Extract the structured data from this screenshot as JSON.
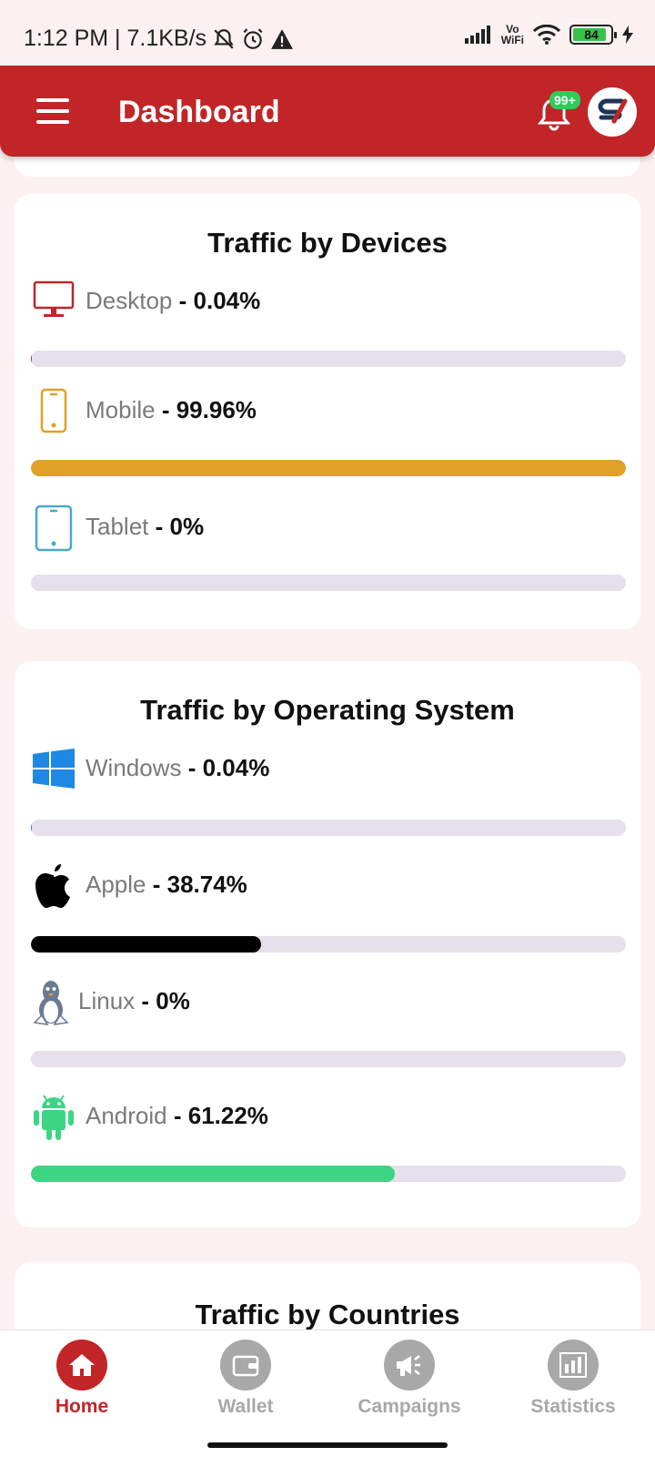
{
  "status_bar": {
    "time_speed": "1:12 PM | 7.1KB/s",
    "vowifi_top": "Vo",
    "vowifi_bottom": "WiFi",
    "battery": "84"
  },
  "appbar": {
    "title": "Dashboard",
    "notification_count": "99+"
  },
  "devices_card": {
    "title": "Traffic by Devices",
    "items": [
      {
        "label": "Desktop",
        "value": "- 0.04%",
        "percent": 0.04,
        "color": "#c12528"
      },
      {
        "label": "Mobile",
        "value": "- 99.96%",
        "percent": 99.96,
        "color": "#e0a126"
      },
      {
        "label": "Tablet",
        "value": "- 0%",
        "percent": 0,
        "color": "#4aa9c6"
      }
    ]
  },
  "os_card": {
    "title": "Traffic by Operating System",
    "items": [
      {
        "label": "Windows",
        "value": "- 0.04%",
        "percent": 0.04,
        "color": "#1e88e5"
      },
      {
        "label": "Apple",
        "value": "- 38.74%",
        "percent": 38.74,
        "color": "#000000"
      },
      {
        "label": "Linux",
        "value": "- 0%",
        "percent": 0,
        "color": "#6b7a90"
      },
      {
        "label": "Android",
        "value": "- 61.22%",
        "percent": 61.22,
        "color": "#3bd583"
      }
    ]
  },
  "countries_card": {
    "title": "Traffic by Countries"
  },
  "bottom_nav": {
    "items": [
      {
        "label": "Home",
        "active": true
      },
      {
        "label": "Wallet",
        "active": false
      },
      {
        "label": "Campaigns",
        "active": false
      },
      {
        "label": "Statistics",
        "active": false
      }
    ],
    "active_color": "#c12528",
    "inactive_color": "#a8a8a8"
  },
  "icons": [
    "menu-icon",
    "bell-icon",
    "avatar-logo",
    "desktop-icon",
    "mobile-icon",
    "tablet-icon",
    "windows-icon",
    "apple-icon",
    "linux-icon",
    "android-icon",
    "home-icon",
    "wallet-icon",
    "megaphone-icon",
    "bar-chart-icon"
  ]
}
